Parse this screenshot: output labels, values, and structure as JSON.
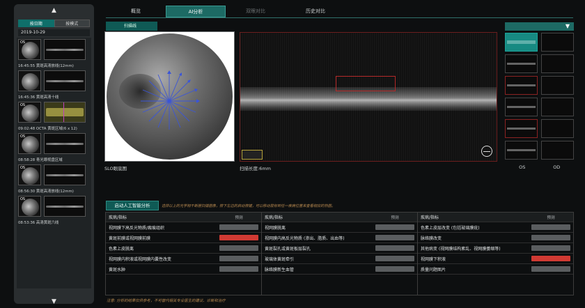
{
  "sidebar": {
    "tabs": [
      {
        "label": "按日期",
        "active": true
      },
      {
        "label": "按模式",
        "active": false
      }
    ],
    "date": "2019-10-29",
    "items": [
      {
        "eye": "OS",
        "caption": "16:45:55 黄斑高清放线(12mm)",
        "type": "oct"
      },
      {
        "eye": "",
        "caption": "16:45:36 黄斑高清十线",
        "type": "oct"
      },
      {
        "eye": "OS",
        "caption": "09:02:48 OCTA 黄斑区域(6 x 12)",
        "type": "octa"
      },
      {
        "eye": "OS",
        "caption": "08:58:28 青光眼视盘区域",
        "type": "blue"
      },
      {
        "eye": "OS",
        "caption": "08:56:30 黄斑高清放线(12mm)",
        "type": "oct"
      },
      {
        "eye": "OS",
        "caption": "08:53:36 高清黄斑六线",
        "type": "oct"
      }
    ]
  },
  "top_tabs": [
    {
      "label": "概览",
      "state": "normal"
    },
    {
      "label": "AI分析",
      "state": "active"
    },
    {
      "label": "双眼对比",
      "state": "dim"
    },
    {
      "label": "历史对比",
      "state": "normal"
    }
  ],
  "viewer": {
    "scan_button": "扫描线",
    "slo_caption": "SLO眼底图",
    "oct_caption": "扫描长度:6mm"
  },
  "right_column": {
    "eye_labels": [
      "OS",
      "OD"
    ]
  },
  "ai": {
    "start_button": "启动人工智能分析",
    "hint": "选择以上的光学相干断层扫描图像，按下左边的启动按键，可以移动鼠标到任一疾病位置来查看相应的热图。",
    "header_disease": "疾病/指标",
    "header_pred": "预测",
    "columns": [
      [
        {
          "name": "视网膜下高反光物质/瘢痕组织",
          "positive": false
        },
        {
          "name": "黄斑前膜或视网膜前膜",
          "positive": true
        },
        {
          "name": "色素上皮脱离",
          "positive": false
        },
        {
          "name": "视网膜内积液或视网膜内囊性改变",
          "positive": false
        },
        {
          "name": "黄斑水肿",
          "positive": false
        }
      ],
      [
        {
          "name": "视网膜脱离",
          "positive": false
        },
        {
          "name": "视网膜内高反光物质 (渗出、脂质、出血等)",
          "positive": false
        },
        {
          "name": "黄斑裂孔或黄斑板层裂孔",
          "positive": false
        },
        {
          "name": "玻璃体黄斑牵引",
          "positive": false
        },
        {
          "name": "脉络膜新生血管",
          "positive": false
        }
      ],
      [
        {
          "name": "色素上皮层改变 (包括玻璃膜疣)",
          "positive": false
        },
        {
          "name": "脉络膜改变",
          "positive": false
        },
        {
          "name": "其他病变 (视网膜结构紊乱、视网膜萎缩等)",
          "positive": false
        },
        {
          "name": "视网膜下积液",
          "positive": true
        },
        {
          "name": "质量问题图片",
          "positive": false
        }
      ]
    ],
    "note": "注意: 分析的结果仅供参考，不可替代相关专业医生的建议、诊断和治疗"
  },
  "colors": {
    "accent": "#1d6a64",
    "positive": "#d03a33",
    "negative": "#5a5d5f",
    "hint": "#b98a50"
  }
}
